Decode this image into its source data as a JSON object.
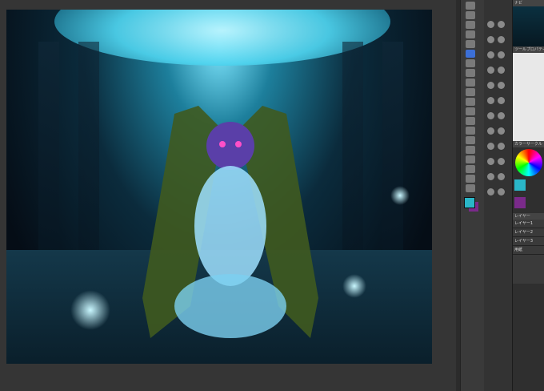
{
  "app": {
    "colors": {
      "accent": "#3c6fd6",
      "panel_bg": "#2f2f2f",
      "main_color": "#2ab6c8",
      "sub_color": "#7a2a8a"
    }
  },
  "canvas": {
    "artwork_description_icon": "illustration-artwork"
  },
  "tools": {
    "items": [
      {
        "icon": "zoom-icon"
      },
      {
        "icon": "move-icon"
      },
      {
        "icon": "select-icon"
      },
      {
        "icon": "lasso-icon"
      },
      {
        "icon": "eyedropper-icon"
      },
      {
        "icon": "pen-icon"
      },
      {
        "icon": "pencil-icon"
      },
      {
        "icon": "brush-icon"
      },
      {
        "icon": "airbrush-icon"
      },
      {
        "icon": "decoration-icon"
      },
      {
        "icon": "eraser-icon"
      },
      {
        "icon": "blend-icon"
      },
      {
        "icon": "fill-icon"
      },
      {
        "icon": "gradient-icon"
      },
      {
        "icon": "figure-icon"
      },
      {
        "icon": "frame-icon"
      },
      {
        "icon": "ruler-icon"
      },
      {
        "icon": "text-icon"
      },
      {
        "icon": "balloon-icon"
      },
      {
        "icon": "correct-line-icon"
      }
    ]
  },
  "panels": {
    "navigator": {
      "label": "ナビ"
    },
    "tool_property": {
      "label": "ツールプロパティ"
    },
    "color_wheel": {
      "label": "カラーサークル"
    },
    "layers": {
      "label": "レイヤー",
      "rows": [
        {
          "name": "レイヤー1"
        },
        {
          "name": "レイヤー2"
        },
        {
          "name": "レイヤー3"
        },
        {
          "name": "用紙"
        }
      ]
    }
  }
}
